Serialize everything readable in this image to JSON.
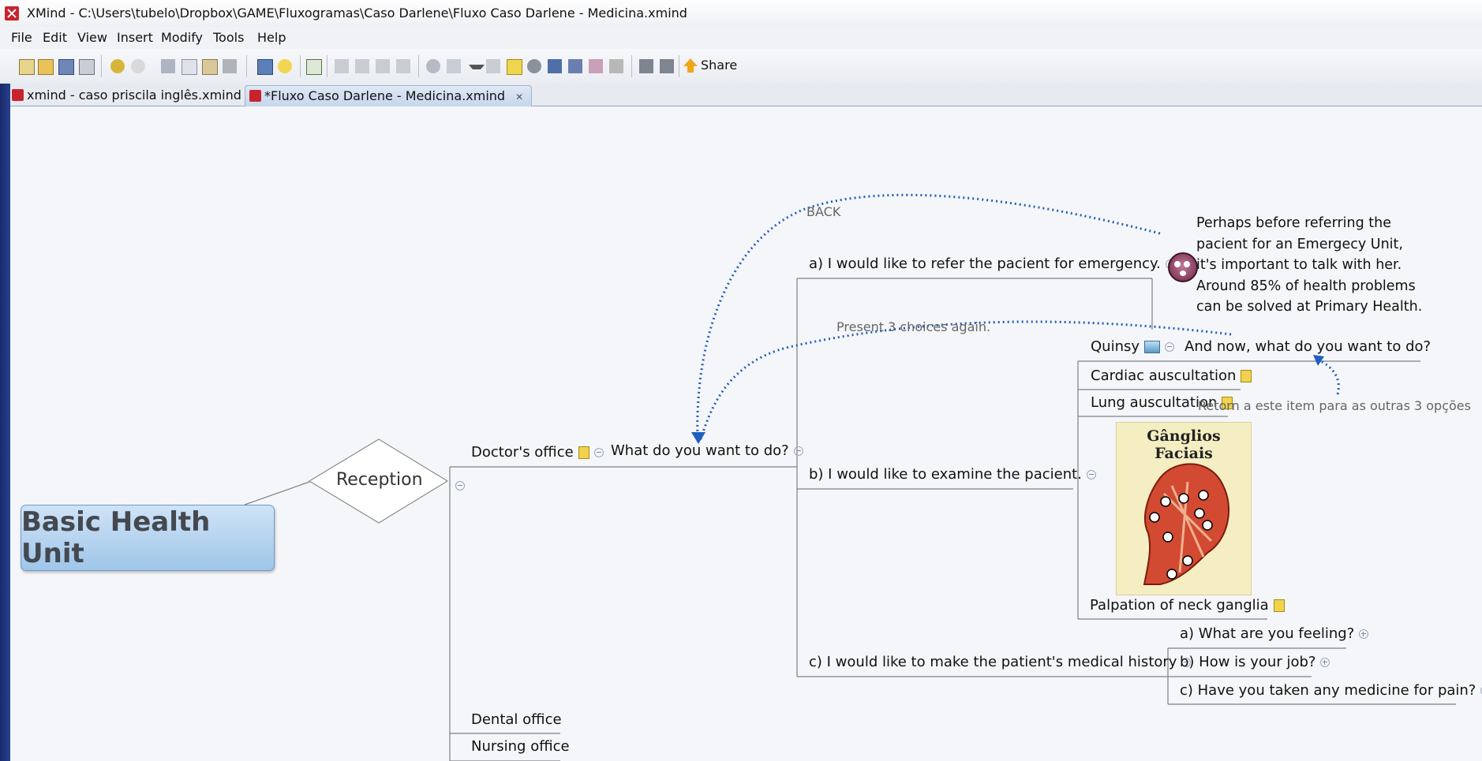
{
  "window": {
    "title": "XMind - C:\\Users\\tubelo\\Dropbox\\GAME\\Fluxogramas\\Caso Darlene\\Fluxo Caso Darlene - Medicina.xmind"
  },
  "menu": [
    "File",
    "Edit",
    "View",
    "Insert",
    "Modify",
    "Tools",
    "Help"
  ],
  "toolbar": {
    "share_label": "Share",
    "icons": [
      "new-icon",
      "open-icon",
      "save-icon",
      "print-icon",
      "undo-icon",
      "redo-icon",
      "cut-icon",
      "copy-icon",
      "paste-icon",
      "delete-icon",
      "topic-icon",
      "idea-icon",
      "map-icon",
      "subtopic-icon",
      "callout-icon",
      "boundary-icon",
      "summary-icon",
      "attachment-icon",
      "image-icon",
      "dropdown-icon",
      "list-icon",
      "note-icon",
      "marker-icon",
      "label-icon",
      "structure-icon",
      "relationship-icon",
      "stop-icon",
      "drill-down-icon",
      "drill-up-icon"
    ]
  },
  "tabs": [
    {
      "label": "xmind - caso priscila inglês.xmind",
      "active": false
    },
    {
      "label": "*Fluxo Caso Darlene - Medicina.xmind",
      "active": true
    }
  ],
  "map": {
    "central": "Basic Health Unit",
    "reception": "Reception",
    "doctors_office": "Doctor's office",
    "what_do_you_want": "What do you want to do?",
    "dental_office": "Dental office",
    "nursing_office": "Nursing office",
    "option_a": "a) I would like to refer the pacient for emergency.",
    "option_b": "b) I would like to examine the pacient.",
    "option_c": "c) I would like to make the patient's medical history",
    "callout_lines": [
      "Perhaps before referring the",
      "pacient for an Emergecy Unit,",
      "it's important to talk with her.",
      "Around 85% of health problems",
      "can be solved at Primary Health."
    ],
    "back_label": "BACK",
    "present_choices": "Present 3 choices again.",
    "quinsy": "Quinsy",
    "and_now": "And now, what do you want to do?",
    "cardiac": "Cardiac auscultation",
    "lung": "Lung auscultation",
    "overlap_text": "Retorn a este item para as outras 3 opções",
    "image_title": "Gânglios Faciais",
    "palpation": "Palpation of neck ganglia",
    "history_a": "a) What are you feeling?",
    "history_b": "b) How is your job?",
    "history_c": "c) Have you taken any medicine for pain?"
  },
  "colors": {
    "relationship": "#1f5fbf",
    "central_fill": "#a9cdee",
    "canvas": "#f5f6f9"
  }
}
